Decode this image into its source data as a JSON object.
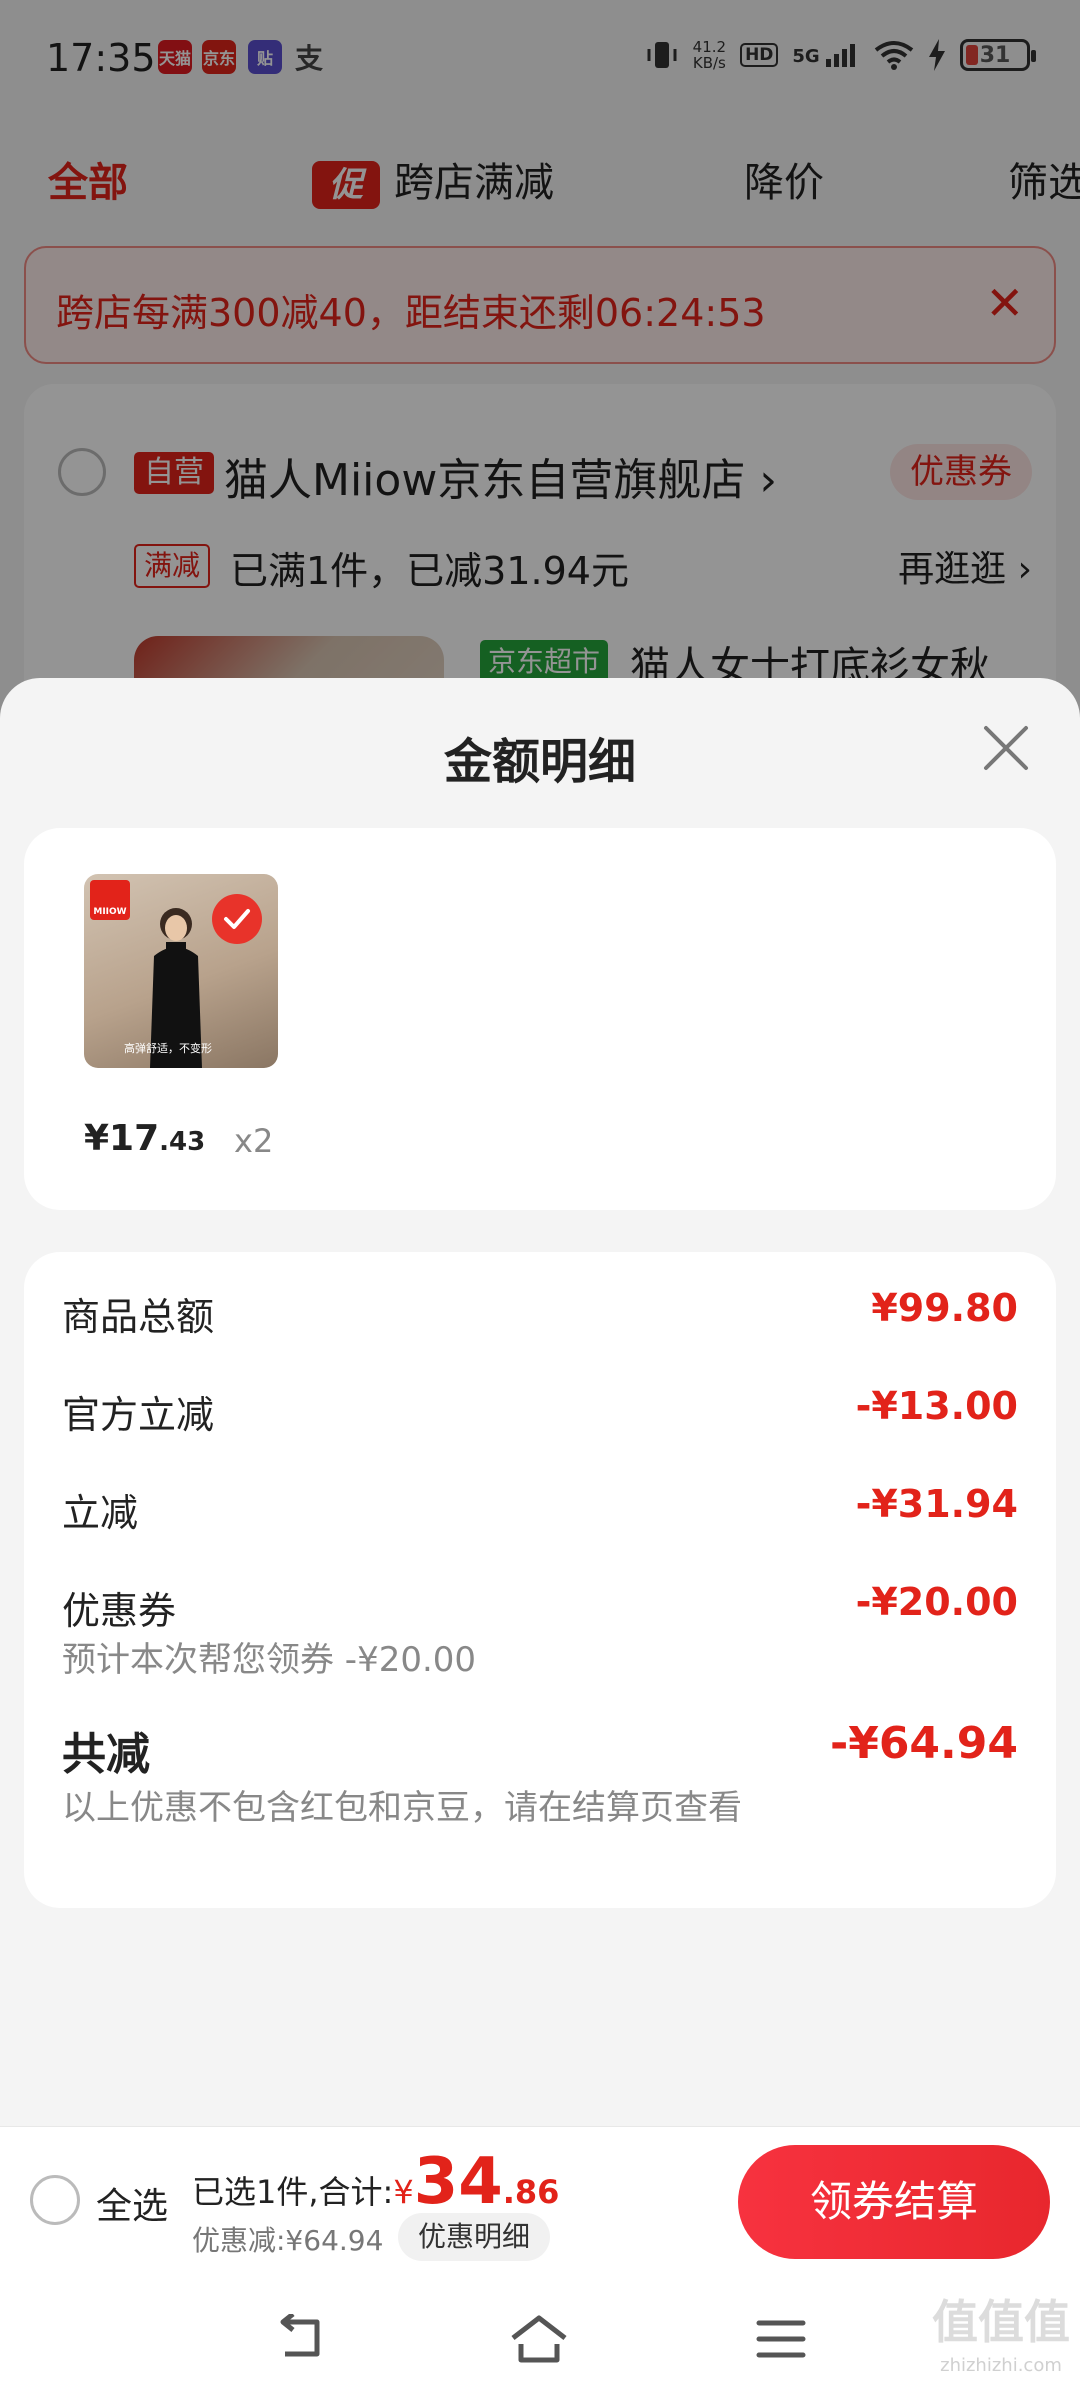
{
  "status_bar": {
    "time": "17:35",
    "net_speed_value": "41.2",
    "net_speed_unit": "KB/s",
    "hd": "HD",
    "signal": "5G",
    "battery": "31",
    "app_icons": [
      "天猫",
      "京东",
      "贴",
      "支"
    ]
  },
  "filter_bar": {
    "all": "全部",
    "promo_tag": "促",
    "cross_store": "跨店满减",
    "price_drop": "降价",
    "filter": "筛选"
  },
  "countdown": {
    "text": "跨店每满300减40，距结束还剩06:24:53"
  },
  "store": {
    "self_run_tag": "自营",
    "name": "猫人Miiow京东自营旗舰店",
    "coupon_badge": "优惠券",
    "promo_tag": "满减",
    "promo_text": "已满1件，已减31.94元",
    "browse_more": "再逛逛",
    "product_tag": "京东超市",
    "product_title": "猫人女士打底衫女秋"
  },
  "sheet": {
    "title": "金额明细",
    "item": {
      "logo": "MIIOW",
      "caption": "高弹舒适，不变形",
      "price_int": "¥17",
      "price_dec": ".43",
      "qty": "x2"
    },
    "amounts": {
      "goods_total_label": "商品总额",
      "goods_total_value": "¥99.80",
      "official_cut_label": "官方立减",
      "official_cut_value": "-¥13.00",
      "instant_cut_label": "立减",
      "instant_cut_value": "-¥31.94",
      "coupon_label": "优惠券",
      "coupon_value": "-¥20.00",
      "coupon_sub": "预计本次帮您领券 -¥20.00",
      "total_cut_label": "共减",
      "total_cut_value": "-¥64.94",
      "total_cut_sub": "以上优惠不包含红包和京豆，请在结算页查看"
    }
  },
  "checkout": {
    "select_all": "全选",
    "selected_text": "已选1件,合计:",
    "total_yen": "¥",
    "total_int": "34",
    "total_dec": ".86",
    "discount_text": "优惠减:¥64.94",
    "detail_button": "优惠明细",
    "checkout_button": "领券结算"
  },
  "watermark": {
    "main": "值值值",
    "sub": "zhizhizhi.com"
  },
  "colors": {
    "accent": "#e2231a",
    "button": "#f7323f"
  }
}
